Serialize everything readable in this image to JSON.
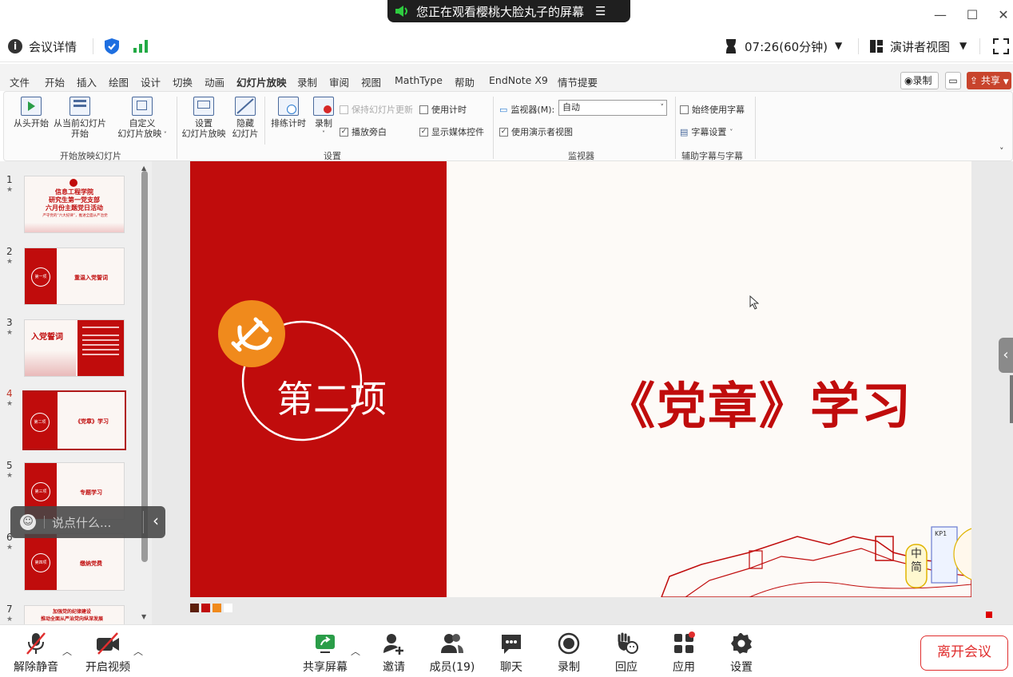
{
  "banner": {
    "text": "您正在观看樱桃大脸丸子的屏幕"
  },
  "window": {
    "minimize": "—",
    "maximize": "☐",
    "close": "✕"
  },
  "info": {
    "meeting_details": "会议详情",
    "timer": "07:26(60分钟)",
    "presenter_view": "演讲者视图"
  },
  "ribbon": {
    "tabs": [
      "文件",
      "开始",
      "插入",
      "绘图",
      "设计",
      "切换",
      "动画",
      "幻灯片放映",
      "录制",
      "审阅",
      "视图",
      "MathType",
      "帮助",
      "EndNote X9",
      "情节提要"
    ],
    "record_btn": "录制",
    "share_btn": "共享",
    "g1": {
      "from_start": "从头开始",
      "from_current_1": "从当前幻灯片",
      "from_current_2": "开始",
      "custom_1": "自定义",
      "custom_2": "幻灯片放映",
      "label": "开始放映幻灯片"
    },
    "g2": {
      "setup_1": "设置",
      "setup_2": "幻灯片放映",
      "hide_1": "隐藏",
      "hide_2": "幻灯片",
      "rehearse": "排练计时",
      "record": "录制",
      "keep_updated": "保持幻灯片更新",
      "play_narration": "播放旁白",
      "use_timing": "使用计时",
      "show_media": "显示媒体控件",
      "label": "设置"
    },
    "g3": {
      "monitor": "监视器(M):",
      "monitor_value": "自动",
      "use_presenter": "使用演示者视图",
      "label": "监视器"
    },
    "g4": {
      "always_subtitles": "始终使用字幕",
      "subtitle_settings": "字幕设置",
      "label": "辅助字幕与字幕"
    }
  },
  "thumbnails": [
    {
      "num": "1",
      "lines": [
        "信息工程学院",
        "研究生第一党支部",
        "六月份主题党日活动"
      ],
      "sub": "严守党的“六大纪律”，推进全面从严治党"
    },
    {
      "num": "2",
      "badge": "第一项",
      "text": "重温入党誓词"
    },
    {
      "num": "3",
      "heading": "入党誓词"
    },
    {
      "num": "4",
      "badge": "第二项",
      "text": "《党章》学习"
    },
    {
      "num": "5",
      "badge": "第三项",
      "text": "专题学习"
    },
    {
      "num": "6",
      "badge": "第四项",
      "text": "缴纳党费"
    },
    {
      "num": "7",
      "lines": [
        "加强党的纪律建设",
        "推动全面从严治党向纵深发展"
      ]
    }
  ],
  "slide": {
    "section": "第二项",
    "title": "《党章》学习",
    "badge_chars": [
      "中",
      "简"
    ],
    "sign_text": "KP1"
  },
  "chat": {
    "placeholder": "说点什么..."
  },
  "toolbar": {
    "unmute": "解除静音",
    "start_video": "开启视频",
    "share_screen": "共享屏幕",
    "invite": "邀请",
    "members": "成员(19)",
    "chat": "聊天",
    "record": "录制",
    "react": "回应",
    "apps": "应用",
    "settings": "设置",
    "leave": "离开会议"
  },
  "colors": {
    "party_red": "#c00c0c",
    "accent_red": "#e02e2e",
    "green": "#22aa44",
    "blue": "#1e6fe0"
  }
}
